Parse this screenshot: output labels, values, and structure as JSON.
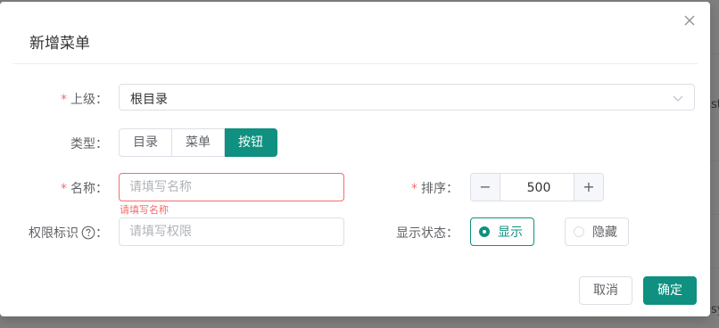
{
  "background": {
    "fragments": [
      "ste",
      "sy"
    ]
  },
  "dialog": {
    "title": "新增菜单",
    "close_icon": "close-icon"
  },
  "form": {
    "parent": {
      "label": "上级：",
      "value": "根目录",
      "required": true
    },
    "type": {
      "label": "类型：",
      "options": [
        "目录",
        "菜单",
        "按钮"
      ],
      "selected": "按钮"
    },
    "name": {
      "label": "名称：",
      "required": true,
      "placeholder": "请填写名称",
      "value": "",
      "error": "请填写名称"
    },
    "sort": {
      "label": "排序：",
      "required": true,
      "value": "500",
      "minus": "−",
      "plus": "+"
    },
    "permission": {
      "label": "权限标识",
      "placeholder": "请填写权限",
      "value": "",
      "help_icon": "question-circle-icon"
    },
    "visibility": {
      "label": "显示状态：",
      "options": [
        "显示",
        "隐藏"
      ],
      "selected": "显示"
    }
  },
  "footer": {
    "cancel_label": "取消",
    "confirm_label": "确定"
  },
  "colors": {
    "primary": "#109080",
    "required": "#f56c6c",
    "border": "#dcdfe6"
  }
}
